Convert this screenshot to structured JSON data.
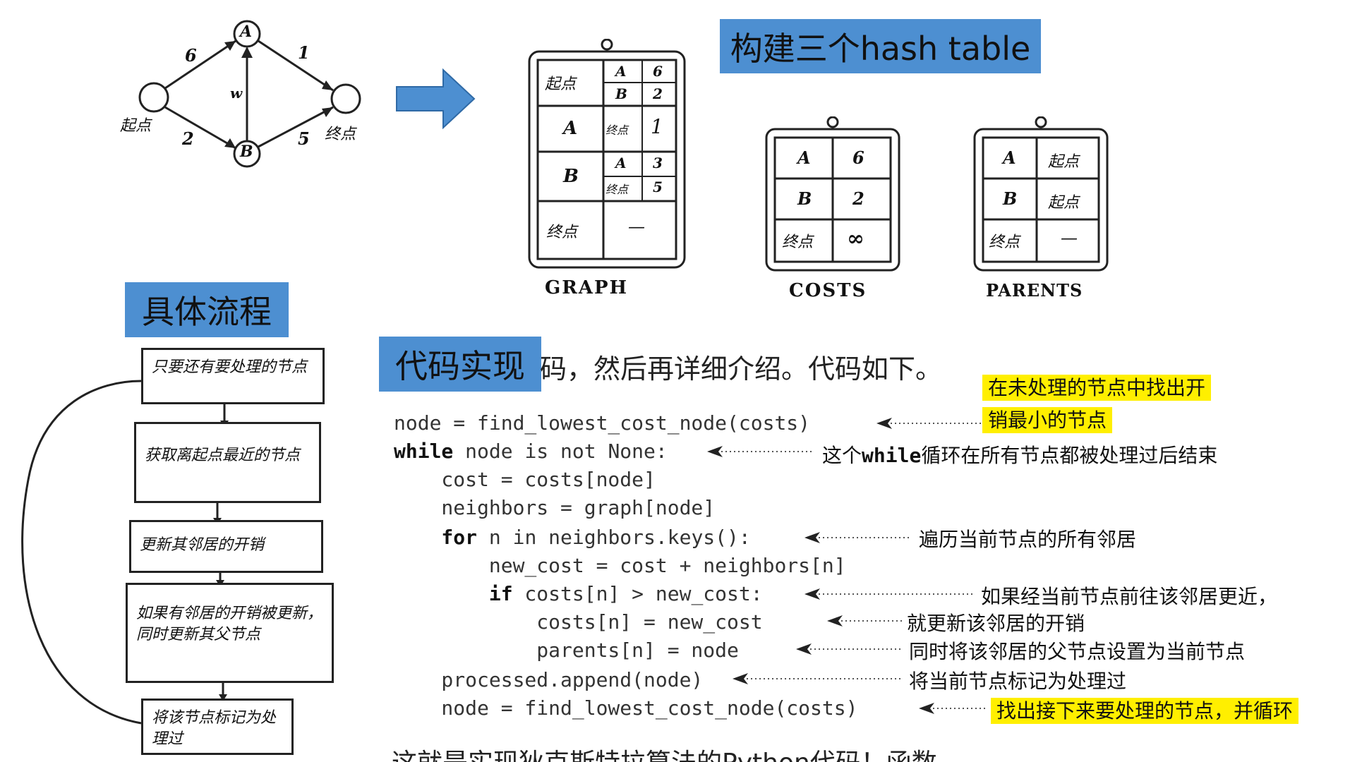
{
  "labels": {
    "hash_tables": "构建三个hash table",
    "flow": "具体流程",
    "code": "代码实现"
  },
  "graph": {
    "nodes": {
      "start": "起点",
      "a": "A",
      "b": "B",
      "end": "终点"
    },
    "edges": {
      "start_a": "6",
      "start_b": "2",
      "b_a": "w",
      "a_end": "1",
      "b_end": "5"
    }
  },
  "tables": {
    "graph": {
      "title": "GRAPH",
      "start_key": "起点",
      "start_vals": [
        [
          "A",
          "6"
        ],
        [
          "B",
          "2"
        ]
      ],
      "a_key": "A",
      "a_vals": [
        [
          "终点",
          "1"
        ]
      ],
      "b_key": "B",
      "b_vals": [
        [
          "A",
          "3"
        ],
        [
          "终点",
          "5"
        ]
      ],
      "end_key": "终点",
      "end_val": "—"
    },
    "costs": {
      "title": "COSTS",
      "rows": [
        [
          "A",
          "6"
        ],
        [
          "B",
          "2"
        ],
        [
          "终点",
          "∞"
        ]
      ]
    },
    "parents": {
      "title": "PARENTS",
      "rows": [
        [
          "A",
          "起点"
        ],
        [
          "B",
          "起点"
        ],
        [
          "终点",
          "—"
        ]
      ]
    }
  },
  "flowchart": {
    "steps": [
      "只要还有要处理的节点",
      "获取离起点最近的节点",
      "更新其邻居的开销",
      "如果有邻居的开销被更新，同时更新其父节点",
      "将该节点标记为处理过"
    ]
  },
  "intro_text": "码，然后再详细介绍。代码如下。",
  "code_lines": [
    {
      "kw": "",
      "rest": "node = find_lowest_cost_node(costs)"
    },
    {
      "kw": "while",
      "rest": " node is not None:"
    },
    {
      "kw": "",
      "rest": "    cost = costs[node]"
    },
    {
      "kw": "",
      "rest": "    neighbors = graph[node]"
    },
    {
      "kw": "    for",
      "rest": " n in neighbors.keys():"
    },
    {
      "kw": "",
      "rest": "        new_cost = cost + neighbors[n]"
    },
    {
      "kw": "        if",
      "rest": " costs[n] > new_cost:"
    },
    {
      "kw": "",
      "rest": "            costs[n] = new_cost"
    },
    {
      "kw": "",
      "rest": "            parents[n] = node"
    },
    {
      "kw": "",
      "rest": "    processed.append(node)"
    },
    {
      "kw": "",
      "rest": "    node = find_lowest_cost_node(costs)"
    }
  ],
  "annotations": {
    "find_lowest_1": "在未处理的节点中找出开",
    "find_lowest_2": "销最小的节点",
    "while_pre": "这个",
    "while_kw": "while",
    "while_post": "循环在所有节点都被处理过后结束",
    "for": "遍历当前节点的所有邻居",
    "if": "如果经当前节点前往该邻居更近，",
    "update_cost": "就更新该邻居的开销",
    "update_parent": "同时将该邻居的父节点设置为当前节点",
    "processed": "将当前节点标记为处理过",
    "loop": "找出接下来要处理的节点，并循环"
  },
  "cut_off_text": "这就是实现狄克斯特拉算法的Python代码！函数"
}
